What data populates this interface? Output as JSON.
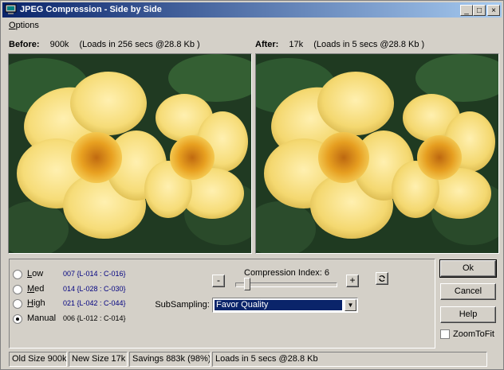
{
  "window": {
    "title": "JPEG Compression - Side by Side",
    "title_icon": "computer-icon",
    "controls": {
      "minimize": "_",
      "maximize": "□",
      "close": "×"
    }
  },
  "menu": {
    "options_prefix": "O",
    "options_rest": "ptions"
  },
  "before": {
    "label": "Before:",
    "size": "900k",
    "load": "(Loads in 256 secs @28.8 Kb )"
  },
  "after": {
    "label": "After:",
    "size": "17k",
    "load": "(Loads in 5 secs @28.8 Kb )"
  },
  "quality": {
    "options": [
      {
        "label_prefix": "L",
        "label_rest": "ow",
        "code": "007 {L-014 : C-016}",
        "checked": false
      },
      {
        "label_prefix": "M",
        "label_rest": "ed",
        "code": "014 {L-028 : C-030}",
        "checked": false
      },
      {
        "label_prefix": "H",
        "label_rest": "igh",
        "code": "021 {L-042 : C-044}",
        "checked": false
      },
      {
        "label_prefix": "",
        "label_rest": "Manual",
        "code": "006 {L-012 : C-014}",
        "checked": true
      }
    ]
  },
  "compression": {
    "label": "Compression Index: 6",
    "minus": "-",
    "plus": "+",
    "value": 6,
    "min": 0,
    "max": 100,
    "reset_icon": "refresh-icon"
  },
  "subsampling": {
    "label": "SubSampling:",
    "value": "Favor Quality"
  },
  "buttons": {
    "ok": "Ok",
    "cancel": "Cancel",
    "help": "Help"
  },
  "zoom": {
    "label": "ZoomToFit",
    "checked": false
  },
  "status": {
    "old": "Old Size 900k",
    "new": "New Size 17k",
    "savings": "Savings 883k (98%)",
    "load": "Loads in 5 secs @28.8 Kb"
  },
  "colors": {
    "title_start": "#0a246a",
    "title_end": "#a6caf0",
    "selection": "#0a246a",
    "code_text": "#000080"
  }
}
